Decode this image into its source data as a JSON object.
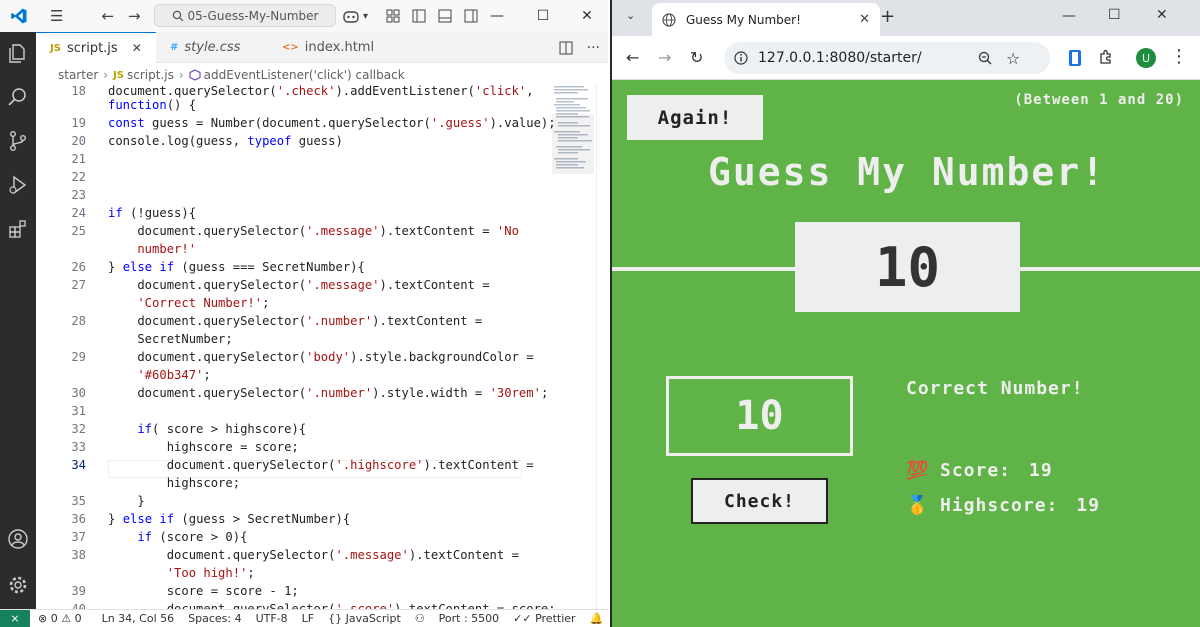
{
  "vscode": {
    "search_text": "05-Guess-My-Number",
    "tabs": [
      {
        "label": "script.js",
        "icon": "JS"
      },
      {
        "label": "style.css",
        "icon": "#"
      },
      {
        "label": "index.html",
        "icon": "<>"
      }
    ],
    "breadcrumb": [
      "starter",
      "script.js",
      "addEventListener('click') callback"
    ],
    "code_lines": [
      {
        "n": "18",
        "parts": [
          [
            "fn",
            "document.querySelector("
          ],
          [
            "str",
            "'.check'"
          ],
          [
            "fn",
            ").addEventListener("
          ],
          [
            "str",
            "'click'"
          ],
          [
            "fn",
            ","
          ]
        ]
      },
      {
        "n": "",
        "parts": [
          [
            "kw",
            "function"
          ],
          [
            "fn",
            "() {"
          ]
        ]
      },
      {
        "n": "19",
        "parts": [
          [
            "kw",
            "const"
          ],
          [
            "fn",
            " guess = Number(document.querySelector("
          ],
          [
            "str",
            "'.guess'"
          ],
          [
            "fn",
            ").value);"
          ]
        ]
      },
      {
        "n": "20",
        "parts": [
          [
            "fn",
            "console.log(guess, "
          ],
          [
            "kw",
            "typeof"
          ],
          [
            "fn",
            " guess)"
          ]
        ]
      },
      {
        "n": "21",
        "parts": []
      },
      {
        "n": "22",
        "parts": []
      },
      {
        "n": "23",
        "parts": []
      },
      {
        "n": "24",
        "parts": [
          [
            "kw",
            "if"
          ],
          [
            "fn",
            " (!guess){"
          ]
        ]
      },
      {
        "n": "25",
        "parts": [
          [
            "fn",
            "    document.querySelector("
          ],
          [
            "str",
            "'.message'"
          ],
          [
            "fn",
            ").textContent = "
          ],
          [
            "str",
            "'No"
          ]
        ]
      },
      {
        "n": "",
        "parts": [
          [
            "str",
            "    number!'"
          ]
        ]
      },
      {
        "n": "26",
        "parts": [
          [
            "fn",
            "} "
          ],
          [
            "kw",
            "else if"
          ],
          [
            "fn",
            " (guess === SecretNumber){"
          ]
        ]
      },
      {
        "n": "27",
        "parts": [
          [
            "fn",
            "    document.querySelector("
          ],
          [
            "str",
            "'.message'"
          ],
          [
            "fn",
            ").textContent ="
          ]
        ]
      },
      {
        "n": "",
        "parts": [
          [
            "str",
            "    'Correct Number!'"
          ],
          [
            "fn",
            ";"
          ]
        ]
      },
      {
        "n": "28",
        "parts": [
          [
            "fn",
            "    document.querySelector("
          ],
          [
            "str",
            "'.number'"
          ],
          [
            "fn",
            ").textContent ="
          ]
        ]
      },
      {
        "n": "",
        "parts": [
          [
            "fn",
            "    SecretNumber;"
          ]
        ]
      },
      {
        "n": "29",
        "parts": [
          [
            "fn",
            "    document.querySelector("
          ],
          [
            "str",
            "'body'"
          ],
          [
            "fn",
            ").style.backgroundColor ="
          ]
        ]
      },
      {
        "n": "",
        "parts": [
          [
            "str",
            "    '#60b347'"
          ],
          [
            "fn",
            ";"
          ]
        ]
      },
      {
        "n": "30",
        "parts": [
          [
            "fn",
            "    document.querySelector("
          ],
          [
            "str",
            "'.number'"
          ],
          [
            "fn",
            ").style.width = "
          ],
          [
            "str",
            "'30rem'"
          ],
          [
            "fn",
            ";"
          ]
        ]
      },
      {
        "n": "31",
        "parts": []
      },
      {
        "n": "32",
        "parts": [
          [
            "kw",
            "    if"
          ],
          [
            "fn",
            "( score > highscore){"
          ]
        ]
      },
      {
        "n": "33",
        "parts": [
          [
            "fn",
            "        highscore = score;"
          ]
        ]
      },
      {
        "n": "34",
        "parts": [
          [
            "fn",
            "        document.querySelector("
          ],
          [
            "str",
            "'.highscore'"
          ],
          [
            "fn",
            ").textContent ="
          ]
        ]
      },
      {
        "n": "",
        "parts": [
          [
            "fn",
            "        highscore;"
          ]
        ]
      },
      {
        "n": "35",
        "parts": [
          [
            "fn",
            "    }"
          ]
        ]
      },
      {
        "n": "36",
        "parts": [
          [
            "fn",
            "} "
          ],
          [
            "kw",
            "else if"
          ],
          [
            "fn",
            " (guess > SecretNumber){"
          ]
        ]
      },
      {
        "n": "37",
        "parts": [
          [
            "kw",
            "    if"
          ],
          [
            "fn",
            " (score > 0){"
          ]
        ]
      },
      {
        "n": "38",
        "parts": [
          [
            "fn",
            "        document.querySelector("
          ],
          [
            "str",
            "'.message'"
          ],
          [
            "fn",
            ").textContent ="
          ]
        ]
      },
      {
        "n": "",
        "parts": [
          [
            "str",
            "        'Too high!'"
          ],
          [
            "fn",
            ";"
          ]
        ]
      },
      {
        "n": "39",
        "parts": [
          [
            "fn",
            "        score = score - 1;"
          ]
        ]
      },
      {
        "n": "40",
        "parts": [
          [
            "fn",
            "        document.querySelector("
          ],
          [
            "str",
            "'.score'"
          ],
          [
            "fn",
            ").textContent = score;"
          ]
        ]
      }
    ],
    "status": {
      "remote": "⨯",
      "problems": "⊗ 0 ⚠ 0",
      "position": "Ln 34, Col 56",
      "spaces": "Spaces: 4",
      "encoding": "UTF-8",
      "eol": "LF",
      "language": "{} JavaScript",
      "port": "Port : 5500",
      "prettier": "✓✓ Prettier"
    }
  },
  "browser": {
    "tab_title": "Guess My Number!",
    "url": "127.0.0.1:8080/starter/",
    "profile_initial": "U"
  },
  "game": {
    "again_label": "Again!",
    "between_text": "(Between 1 and 20)",
    "title": "Guess My Number!",
    "number": "10",
    "guess_value": "10",
    "check_label": "Check!",
    "message": "Correct Number!",
    "score_label": "Score:",
    "score_value": "19",
    "highscore_label": "Highscore:",
    "highscore_value": "19",
    "score_emoji": "💯",
    "highscore_emoji": "🥇",
    "bg_color": "#60b347"
  }
}
